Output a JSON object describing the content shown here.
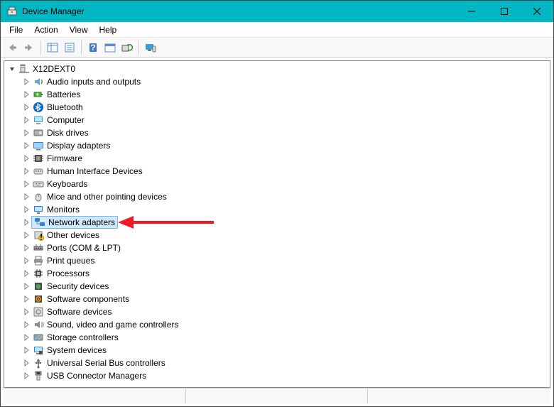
{
  "window": {
    "title": "Device Manager"
  },
  "menubar": {
    "items": [
      {
        "label": "File"
      },
      {
        "label": "Action"
      },
      {
        "label": "View"
      },
      {
        "label": "Help"
      }
    ]
  },
  "toolbar": {
    "buttons": [
      {
        "name": "back-button",
        "icon": "arrow-left-icon"
      },
      {
        "name": "forward-button",
        "icon": "arrow-right-icon"
      },
      {
        "name": "show-hide-tree-button",
        "icon": "tree-pane-icon"
      },
      {
        "name": "properties-button",
        "icon": "properties-icon"
      },
      {
        "name": "help-button",
        "icon": "help-icon"
      },
      {
        "name": "action-event-button",
        "icon": "event-icon"
      },
      {
        "name": "scan-hardware-button",
        "icon": "scan-icon"
      },
      {
        "name": "devices-button",
        "icon": "devices-icon"
      }
    ]
  },
  "tree": {
    "root": {
      "label": "X12DEXT0",
      "icon": "computer-icon",
      "expanded": true
    },
    "children": [
      {
        "label": "Audio inputs and outputs",
        "icon": "audio-icon",
        "expanded": false
      },
      {
        "label": "Batteries",
        "icon": "battery-icon",
        "expanded": false
      },
      {
        "label": "Bluetooth",
        "icon": "bluetooth-icon",
        "expanded": false
      },
      {
        "label": "Computer",
        "icon": "computer-icon",
        "expanded": false
      },
      {
        "label": "Disk drives",
        "icon": "disk-icon",
        "expanded": false
      },
      {
        "label": "Display adapters",
        "icon": "display-icon",
        "expanded": false
      },
      {
        "label": "Firmware",
        "icon": "firmware-icon",
        "expanded": false
      },
      {
        "label": "Human Interface Devices",
        "icon": "hid-icon",
        "expanded": false
      },
      {
        "label": "Keyboards",
        "icon": "keyboard-icon",
        "expanded": false
      },
      {
        "label": "Mice and other pointing devices",
        "icon": "mouse-icon",
        "expanded": false
      },
      {
        "label": "Monitors",
        "icon": "monitor-icon",
        "expanded": false
      },
      {
        "label": "Network adapters",
        "icon": "network-icon",
        "expanded": false,
        "selected": true
      },
      {
        "label": "Other devices",
        "icon": "other-icon",
        "expanded": false
      },
      {
        "label": "Ports (COM & LPT)",
        "icon": "ports-icon",
        "expanded": false
      },
      {
        "label": "Print queues",
        "icon": "printer-icon",
        "expanded": false
      },
      {
        "label": "Processors",
        "icon": "cpu-icon",
        "expanded": false
      },
      {
        "label": "Security devices",
        "icon": "security-icon",
        "expanded": false
      },
      {
        "label": "Software components",
        "icon": "softcomp-icon",
        "expanded": false
      },
      {
        "label": "Software devices",
        "icon": "softdev-icon",
        "expanded": false
      },
      {
        "label": "Sound, video and game controllers",
        "icon": "sound-icon",
        "expanded": false
      },
      {
        "label": "Storage controllers",
        "icon": "storage-icon",
        "expanded": false
      },
      {
        "label": "System devices",
        "icon": "system-icon",
        "expanded": false
      },
      {
        "label": "Universal Serial Bus controllers",
        "icon": "usb-icon",
        "expanded": false
      },
      {
        "label": "USB Connector Managers",
        "icon": "usb-conn-icon",
        "expanded": false
      }
    ]
  },
  "annotation": {
    "arrow_target": "Network adapters",
    "arrow_color": "#ed1c24"
  }
}
